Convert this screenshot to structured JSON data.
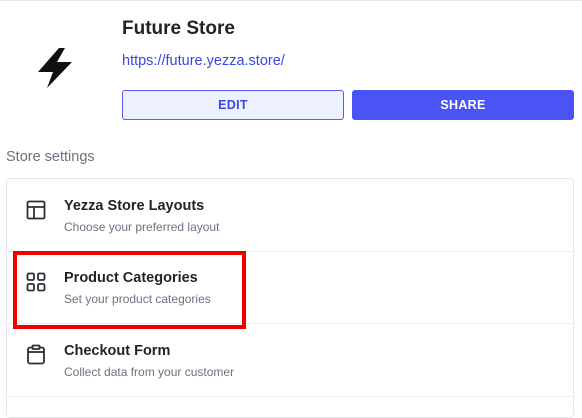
{
  "store": {
    "name": "Future Store",
    "url": "https://future.yezza.store/",
    "logo_icon": "lightning-bolt-icon"
  },
  "actions": {
    "edit_label": "EDIT",
    "share_label": "SHARE"
  },
  "settings": {
    "section_title": "Store settings",
    "items": [
      {
        "title": "Yezza Store Layouts",
        "description": "Choose your preferred layout",
        "icon": "layout-icon"
      },
      {
        "title": "Product Categories",
        "description": "Set your product categories",
        "icon": "grid-icon"
      },
      {
        "title": "Checkout Form",
        "description": "Collect data from your customer",
        "icon": "clipboard-icon"
      }
    ]
  },
  "colors": {
    "accent": "#4a53f3",
    "link": "#3b46e8",
    "highlight": "#ee0000"
  }
}
